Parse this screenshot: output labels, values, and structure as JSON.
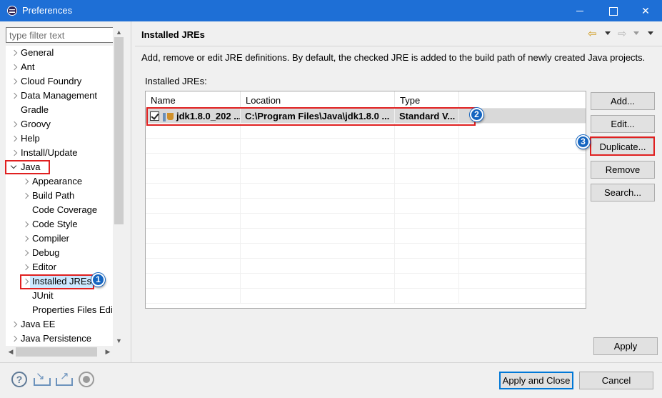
{
  "window": {
    "title": "Preferences",
    "icon": "eclipse-icon"
  },
  "filter": {
    "placeholder": "type filter text",
    "value": ""
  },
  "tree": {
    "items": [
      {
        "label": "General",
        "expander": "collapsed"
      },
      {
        "label": "Ant",
        "expander": "collapsed"
      },
      {
        "label": "Cloud Foundry",
        "expander": "collapsed"
      },
      {
        "label": "Data Management",
        "expander": "collapsed"
      },
      {
        "label": "Gradle",
        "expander": "none"
      },
      {
        "label": "Groovy",
        "expander": "collapsed"
      },
      {
        "label": "Help",
        "expander": "collapsed"
      },
      {
        "label": "Install/Update",
        "expander": "collapsed"
      },
      {
        "label": "Java",
        "expander": "expanded"
      },
      {
        "label": "Appearance",
        "expander": "collapsed"
      },
      {
        "label": "Build Path",
        "expander": "collapsed"
      },
      {
        "label": "Code Coverage",
        "expander": "none"
      },
      {
        "label": "Code Style",
        "expander": "collapsed"
      },
      {
        "label": "Compiler",
        "expander": "collapsed"
      },
      {
        "label": "Debug",
        "expander": "collapsed"
      },
      {
        "label": "Editor",
        "expander": "collapsed"
      },
      {
        "label": "Installed JREs",
        "expander": "collapsed",
        "selected": true
      },
      {
        "label": "JUnit",
        "expander": "none"
      },
      {
        "label": "Properties Files Edit",
        "expander": "none"
      },
      {
        "label": "Java EE",
        "expander": "collapsed"
      },
      {
        "label": "Java Persistence",
        "expander": "collapsed"
      }
    ]
  },
  "page": {
    "title": "Installed JREs",
    "description": "Add, remove or edit JRE definitions. By default, the checked JRE is added to the build path of newly created Java projects.",
    "list_label": "Installed JREs:"
  },
  "table": {
    "headers": {
      "name": "Name",
      "location": "Location",
      "type": "Type"
    },
    "rows": [
      {
        "checked": true,
        "name": "jdk1.8.0_202 ...",
        "location": "C:\\Program Files\\Java\\jdk1.8.0 ...",
        "type": "Standard V..."
      }
    ]
  },
  "buttons": {
    "add": "Add...",
    "edit": "Edit...",
    "duplicate": "Duplicate...",
    "remove": "Remove",
    "search": "Search...",
    "apply": "Apply",
    "apply_close": "Apply and Close",
    "cancel": "Cancel"
  },
  "annotations": {
    "badge1": "1",
    "badge2": "2",
    "badge3": "3"
  },
  "colors": {
    "titlebar": "#1e6fd6",
    "highlight": "#e02020",
    "badge": "#1565c0",
    "selection": "#cce8ff"
  }
}
